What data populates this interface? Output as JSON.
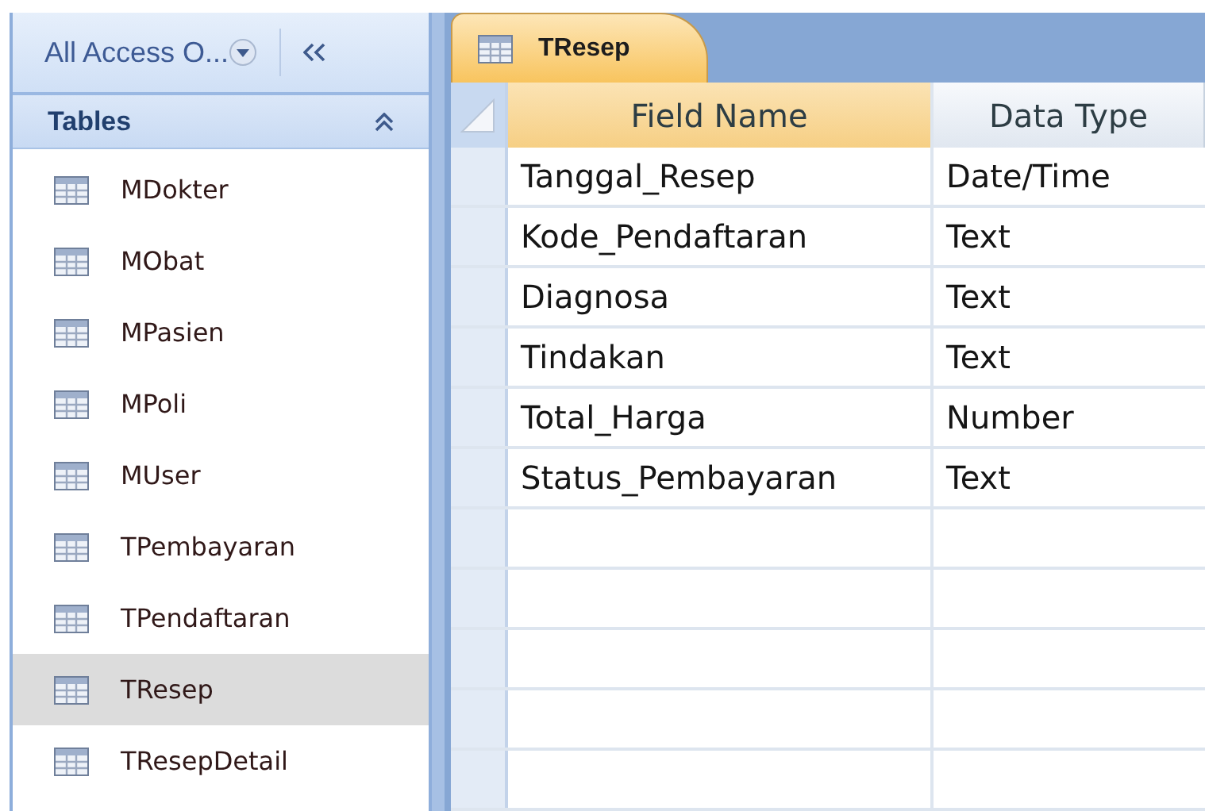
{
  "navigation_pane": {
    "title": "All Access O...",
    "section": {
      "title": "Tables",
      "expanded": true,
      "items": [
        {
          "label": "MDokter",
          "selected": false
        },
        {
          "label": "MObat",
          "selected": false
        },
        {
          "label": "MPasien",
          "selected": false
        },
        {
          "label": "MPoli",
          "selected": false
        },
        {
          "label": "MUser",
          "selected": false
        },
        {
          "label": "TPembayaran",
          "selected": false
        },
        {
          "label": "TPendaftaran",
          "selected": false
        },
        {
          "label": "TResep",
          "selected": true
        },
        {
          "label": "TResepDetail",
          "selected": false
        }
      ]
    }
  },
  "tabs": [
    {
      "label": "TResep",
      "selected": true
    }
  ],
  "design_grid": {
    "columns": [
      {
        "label": "Field Name",
        "selected": true
      },
      {
        "label": "Data Type",
        "selected": false
      }
    ],
    "rows": [
      {
        "field_name": "Tanggal_Resep",
        "data_type": "Date/Time"
      },
      {
        "field_name": "Kode_Pendaftaran",
        "data_type": "Text"
      },
      {
        "field_name": "Diagnosa",
        "data_type": "Text"
      },
      {
        "field_name": "Tindakan",
        "data_type": "Text"
      },
      {
        "field_name": "Total_Harga",
        "data_type": "Number"
      },
      {
        "field_name": "Status_Pembayaran",
        "data_type": "Text"
      }
    ]
  }
}
